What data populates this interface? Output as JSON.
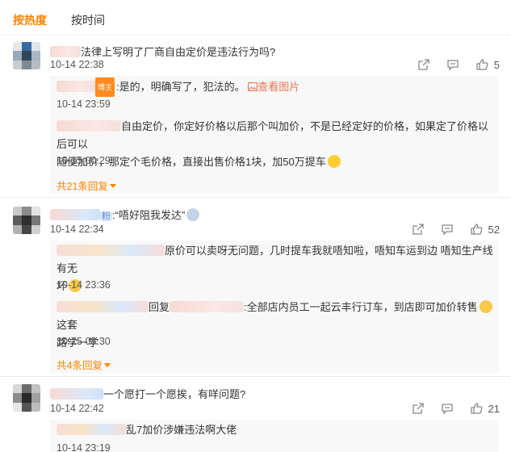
{
  "tabs": {
    "hot": "按热度",
    "time": "按时间"
  },
  "comments": [
    {
      "text": "法律上写明了厂商自由定价是违法行为吗?",
      "time": "10-14 22:38",
      "likes": "5",
      "replies": [
        {
          "badge": "博主",
          "text": ":是的，明确写了，犯法的。",
          "link": "查看图片",
          "time": "10-14 23:59"
        },
        {
          "text_line1": "自由定价，你定好价格以后那个叫加价，不是已经定好的价格，如果定了价格以后可以",
          "text_line2": "随便加价，那定个毛价格，直接出售价格1块，加50万提车",
          "time": "10-15 00:29"
        }
      ],
      "more": "共21条回复"
    },
    {
      "tag": "粉",
      "text": ":“唔好阻我发达”",
      "time": "10-14 22:34",
      "likes": "52",
      "replies": [
        {
          "text_line1": "原价可以卖呀无问题，几时提车我就唔知啦，唔知车运到边 唔知生产线有无",
          "text_line2": "坏",
          "time": "10-14 23:36"
        },
        {
          "prefix": "回复",
          "text_line1": ":全部店内员工一起云丰行订车，到店即可加价转售",
          "text_line1b": "这套",
          "text_line2": "路学一学",
          "time": "10-15 08:30"
        }
      ],
      "more": "共4条回复"
    },
    {
      "text": "一个愿打一个愿挨，有咩问题?",
      "time": "10-14 22:42",
      "likes": "21",
      "replies": [
        {
          "text_line1": "乱7加价涉嫌违法啊大佬",
          "time": "10-14 23:19"
        }
      ]
    }
  ],
  "icons": [
    "share-icon",
    "comment-icon",
    "like-icon",
    "image-icon",
    "chevron-down-icon"
  ],
  "colors": {
    "accent": "#ff8200",
    "link": "#eb7350",
    "reply_bg": "#f8f8f8"
  }
}
